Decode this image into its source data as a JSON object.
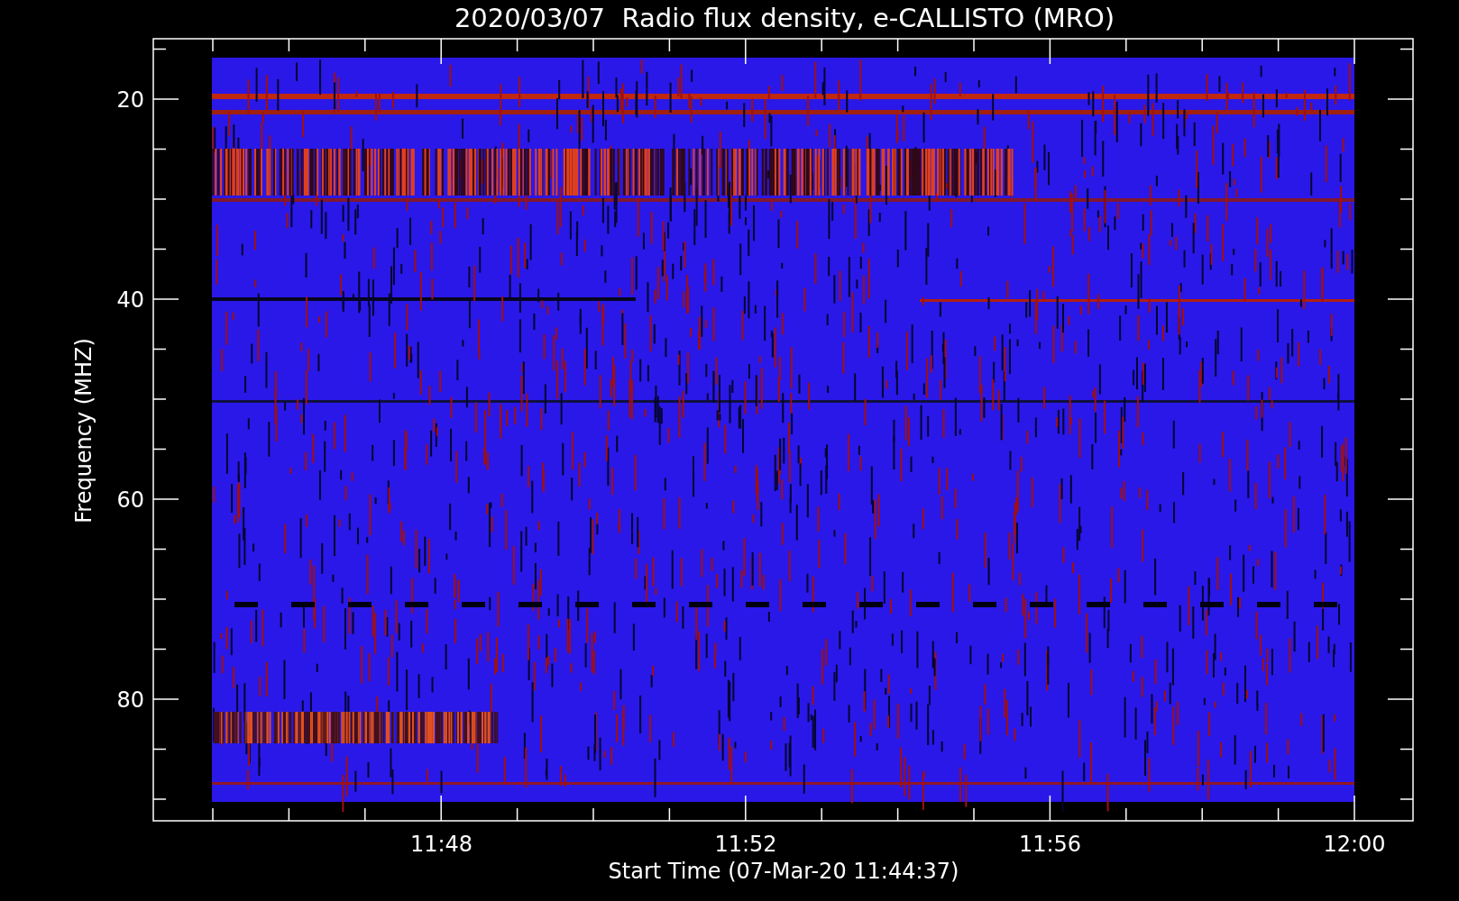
{
  "title": "2020/03/07  Radio flux density, e-CALLISTO (MRO)",
  "plot": {
    "ylabel": "Frequency (MHZ)",
    "xlabel": "Start Time (07-Mar-20 11:44:37)",
    "yticks": [
      "20",
      "40",
      "60",
      "80"
    ],
    "xticks": [
      "11:48",
      "11:52",
      "11:56",
      "12:00"
    ]
  }
}
